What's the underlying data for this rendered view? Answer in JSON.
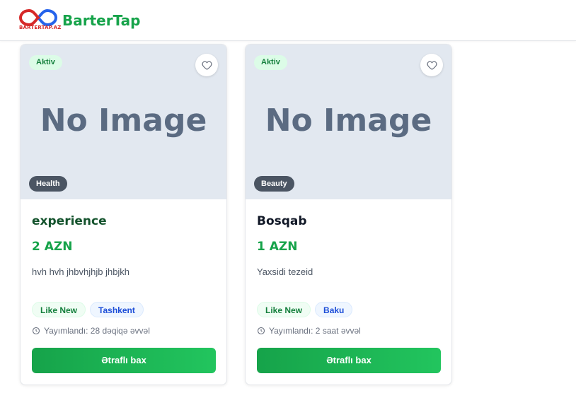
{
  "header": {
    "brand": "BarterTap",
    "logo_text": "BARTERTAP.AZ",
    "brand_color": "#16a34a"
  },
  "listings": [
    {
      "status": "Aktiv",
      "placeholder": "No Image",
      "category": "Health",
      "title": "experience",
      "price": "2 AZN",
      "description": "hvh hvh jhbvhjhjb jhbjkh",
      "condition": "Like New",
      "location": "Tashkent",
      "posted": "Yayımlandı: 28 dəqiqə əvvəl",
      "button": "Ətraflı bax"
    },
    {
      "status": "Aktiv",
      "placeholder": "No Image",
      "category": "Beauty",
      "title": "Bosqab",
      "price": "1 AZN",
      "description": "Yaxsidi tezeid",
      "condition": "Like New",
      "location": "Baku",
      "posted": "Yayımlandı: 2 saat əvvəl",
      "button": "Ətraflı bax"
    }
  ],
  "icons": {
    "favorite": "heart-icon",
    "time": "clock-icon",
    "logo": "infinity-logo-icon"
  }
}
